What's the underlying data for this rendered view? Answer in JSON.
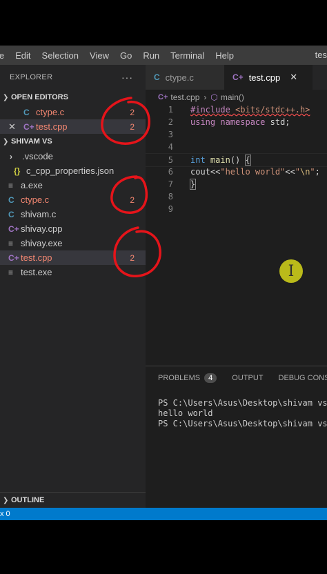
{
  "menu": {
    "items": [
      "le",
      "Edit",
      "Selection",
      "View",
      "Go",
      "Run",
      "Terminal",
      "Help"
    ],
    "title_fragment": "tes"
  },
  "sidebar": {
    "header": "EXPLORER",
    "more": "···",
    "open_editors": {
      "title": "OPEN EDITORS",
      "items": [
        {
          "icon": "C",
          "label": "ctype.c",
          "badge": "2"
        },
        {
          "icon": "C+",
          "label": "test.cpp",
          "badge": "2",
          "close": "✕"
        }
      ]
    },
    "folder": {
      "title": "SHIVAM VS",
      "items": [
        {
          "icon": "›",
          "label": ".vscode"
        },
        {
          "icon": "{}",
          "label": "c_cpp_properties.json"
        },
        {
          "icon": "≡",
          "label": "a.exe"
        },
        {
          "icon": "C",
          "label": "ctype.c",
          "badge": "2"
        },
        {
          "icon": "C",
          "label": "shivam.c"
        },
        {
          "icon": "C+",
          "label": "shivay.cpp"
        },
        {
          "icon": "≡",
          "label": "shivay.exe"
        },
        {
          "icon": "C+",
          "label": "test.cpp",
          "badge": "2"
        },
        {
          "icon": "≡",
          "label": "test.exe"
        }
      ]
    },
    "outline": "OUTLINE"
  },
  "tabs": [
    {
      "icon": "C",
      "label": "ctype.c"
    },
    {
      "icon": "C+",
      "label": "test.cpp",
      "close": "✕"
    }
  ],
  "breadcrumb": {
    "file": "test.cpp",
    "sep": "›",
    "symbol": "main()"
  },
  "editor": {
    "line_numbers": [
      "1",
      "2",
      "3",
      "4",
      "5",
      "6",
      "7",
      "8",
      "9"
    ],
    "l1": {
      "directive": "#include",
      "header": "<bits/stdc++.h>"
    },
    "l2": {
      "kw1": "using",
      "kw2": "namespace",
      "rest": "std;"
    },
    "l5": {
      "type": "int",
      "fn": "main",
      "rest": "()",
      "brace": "{"
    },
    "l6": {
      "pre": "cout<<",
      "str1": "\"hello world\"",
      "op": "<<",
      "q1": "\"",
      "esc": "\\n",
      "q2": "\"",
      "end": ";"
    },
    "l7": {
      "brace": "}"
    }
  },
  "cursor_glyph": "I",
  "panel": {
    "tabs": {
      "problems": "PROBLEMS",
      "problems_count": "4",
      "output": "OUTPUT",
      "debug": "DEBUG CONSOLE"
    },
    "terminal": [
      "PS C:\\Users\\Asus\\Desktop\\shivam vs>",
      "hello world",
      "PS C:\\Users\\Asus\\Desktop\\shivam vs>"
    ]
  },
  "statusbar": {
    "text": "x 0"
  },
  "colors": {
    "accent": "#007acc",
    "error": "#f48771",
    "annotation": "#e5141a"
  }
}
